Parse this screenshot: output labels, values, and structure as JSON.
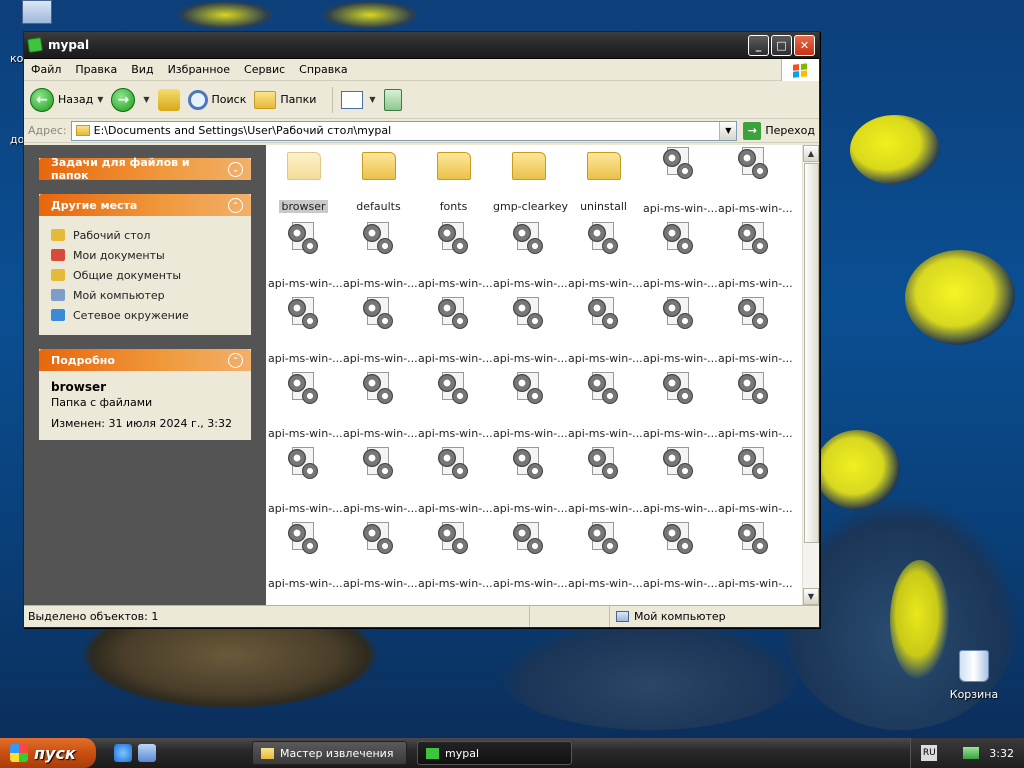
{
  "desktop": {
    "recycle_bin_label": "Корзина",
    "edge_labels": [
      "ко",
      "до"
    ]
  },
  "window": {
    "title": "mypal",
    "menu": [
      "Файл",
      "Правка",
      "Вид",
      "Избранное",
      "Сервис",
      "Справка"
    ],
    "toolbar": {
      "back_label": "Назад",
      "search_label": "Поиск",
      "folders_label": "Папки"
    },
    "address": {
      "label": "Адрес:",
      "value": "E:\\Documents and Settings\\User\\Рабочий стол\\mypal",
      "go_label": "Переход"
    },
    "taskpane": {
      "tasks_title": "Задачи для файлов и папок",
      "other_places_title": "Другие места",
      "other_places": [
        {
          "label": "Рабочий стол",
          "icon": "folder-icon",
          "color": "#e5b93a"
        },
        {
          "label": "Мои документы",
          "icon": "my-documents-icon",
          "color": "#d84a3a"
        },
        {
          "label": "Общие документы",
          "icon": "folder-icon",
          "color": "#e5b93a"
        },
        {
          "label": "Мой компьютер",
          "icon": "computer-icon",
          "color": "#7f9dc9"
        },
        {
          "label": "Сетевое окружение",
          "icon": "network-icon",
          "color": "#3a8ad8"
        }
      ],
      "details_title": "Подробно",
      "details": {
        "name": "browser",
        "type": "Папка с файлами",
        "modified": "Изменен: 31 июля 2024 г., 3:32"
      }
    },
    "files": [
      {
        "label": "browser",
        "kind": "folder-dim",
        "selected": true
      },
      {
        "label": "defaults",
        "kind": "folder"
      },
      {
        "label": "fonts",
        "kind": "folder"
      },
      {
        "label": "gmp-clearkey",
        "kind": "folder"
      },
      {
        "label": "uninstall",
        "kind": "folder"
      },
      {
        "label": "api-ms-win-...",
        "kind": "dll"
      },
      {
        "label": "api-ms-win-...",
        "kind": "dll"
      },
      {
        "label": "api-ms-win-...",
        "kind": "dll"
      },
      {
        "label": "api-ms-win-...",
        "kind": "dll"
      },
      {
        "label": "api-ms-win-...",
        "kind": "dll"
      },
      {
        "label": "api-ms-win-...",
        "kind": "dll"
      },
      {
        "label": "api-ms-win-...",
        "kind": "dll"
      },
      {
        "label": "api-ms-win-...",
        "kind": "dll"
      },
      {
        "label": "api-ms-win-...",
        "kind": "dll"
      },
      {
        "label": "api-ms-win-...",
        "kind": "dll"
      },
      {
        "label": "api-ms-win-...",
        "kind": "dll"
      },
      {
        "label": "api-ms-win-...",
        "kind": "dll"
      },
      {
        "label": "api-ms-win-...",
        "kind": "dll"
      },
      {
        "label": "api-ms-win-...",
        "kind": "dll"
      },
      {
        "label": "api-ms-win-...",
        "kind": "dll"
      },
      {
        "label": "api-ms-win-...",
        "kind": "dll"
      },
      {
        "label": "api-ms-win-...",
        "kind": "dll"
      },
      {
        "label": "api-ms-win-...",
        "kind": "dll"
      },
      {
        "label": "api-ms-win-...",
        "kind": "dll"
      },
      {
        "label": "api-ms-win-...",
        "kind": "dll"
      },
      {
        "label": "api-ms-win-...",
        "kind": "dll"
      },
      {
        "label": "api-ms-win-...",
        "kind": "dll"
      },
      {
        "label": "api-ms-win-...",
        "kind": "dll"
      },
      {
        "label": "api-ms-win-...",
        "kind": "dll"
      },
      {
        "label": "api-ms-win-...",
        "kind": "dll"
      },
      {
        "label": "api-ms-win-...",
        "kind": "dll"
      },
      {
        "label": "api-ms-win-...",
        "kind": "dll"
      },
      {
        "label": "api-ms-win-...",
        "kind": "dll"
      },
      {
        "label": "api-ms-win-...",
        "kind": "dll"
      },
      {
        "label": "api-ms-win-...",
        "kind": "dll"
      },
      {
        "label": "api-ms-win-...",
        "kind": "dll"
      },
      {
        "label": "api-ms-win-...",
        "kind": "dll"
      },
      {
        "label": "api-ms-win-...",
        "kind": "dll"
      },
      {
        "label": "api-ms-win-...",
        "kind": "dll"
      },
      {
        "label": "api-ms-win-...",
        "kind": "dll"
      },
      {
        "label": "api-ms-win-...",
        "kind": "dll"
      },
      {
        "label": "api-ms-win-...",
        "kind": "dll"
      }
    ],
    "status": {
      "selected": "Выделено объектов: 1",
      "location": "Мой компьютер"
    }
  },
  "taskbar": {
    "start_label": "пуск",
    "tasks": [
      "Мастер извлечения",
      "mypal"
    ],
    "tray_lang": "RU",
    "clock": "3:32"
  }
}
